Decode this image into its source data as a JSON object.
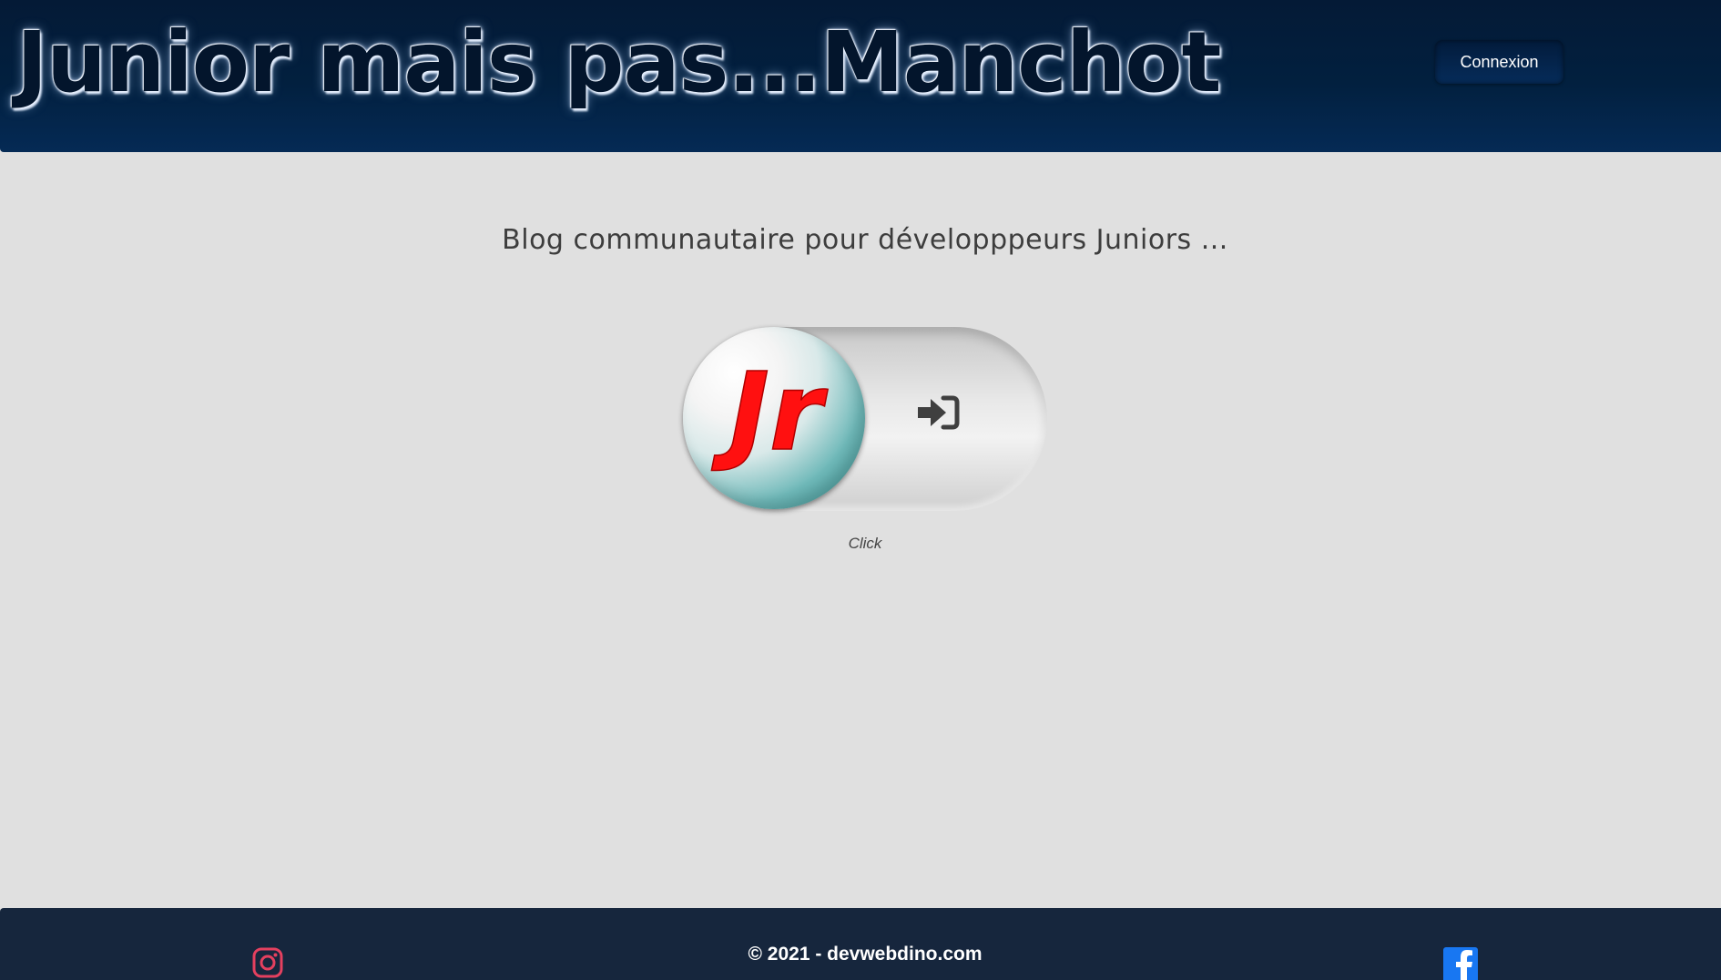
{
  "header": {
    "title": "Junior mais pas...Manchot",
    "login_label": "Connexion"
  },
  "main": {
    "tagline": "Blog communautaire pour développpeurs Juniors ...",
    "toggle": {
      "logo_text": "Jr",
      "icon": "sign-in-icon",
      "caption": "Click"
    }
  },
  "footer": {
    "copyright": "© 2021 - devwebdino.com",
    "social": [
      {
        "name": "instagram-icon",
        "color": "#e4405f"
      },
      {
        "name": "facebook-icon",
        "color": "#1877f2"
      }
    ]
  },
  "colors": {
    "header_bg": "#02203f",
    "page_bg": "#e0e0e0",
    "footer_bg": "#16263d",
    "logo_red": "#ff1010",
    "knob_teal": "#4aa3a3"
  }
}
